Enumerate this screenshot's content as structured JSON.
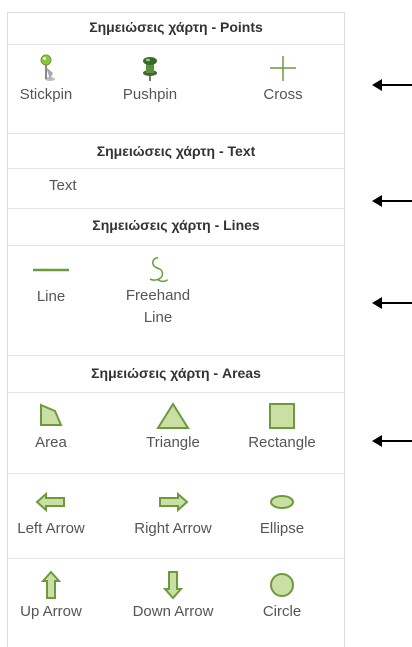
{
  "sections": [
    {
      "header": "Σημειώσεις χάρτη - Points",
      "tools": [
        {
          "label": "Stickpin",
          "icon": "stickpin-icon"
        },
        {
          "label": "Pushpin",
          "icon": "pushpin-icon"
        },
        {
          "label": "Cross",
          "icon": "cross-icon"
        }
      ]
    },
    {
      "header": "Σημειώσεις χάρτη - Text",
      "tools": [
        {
          "label": "Text",
          "icon": "text-tool"
        }
      ]
    },
    {
      "header": "Σημειώσεις χάρτη - Lines",
      "tools": [
        {
          "label": "Line",
          "icon": "line-icon"
        },
        {
          "label": "Freehand Line",
          "icon": "freehand-line-icon"
        }
      ]
    },
    {
      "header": "Σημειώσεις χάρτη - Areas",
      "tools": [
        {
          "label": "Area",
          "icon": "area-icon"
        },
        {
          "label": "Triangle",
          "icon": "triangle-icon"
        },
        {
          "label": "Rectangle",
          "icon": "rectangle-icon"
        },
        {
          "label": "Left Arrow",
          "icon": "left-arrow-icon"
        },
        {
          "label": "Right Arrow",
          "icon": "right-arrow-icon"
        },
        {
          "label": "Ellipse",
          "icon": "ellipse-icon"
        },
        {
          "label": "Up Arrow",
          "icon": "up-arrow-icon"
        },
        {
          "label": "Down Arrow",
          "icon": "down-arrow-icon"
        },
        {
          "label": "Circle",
          "icon": "circle-icon"
        }
      ]
    }
  ],
  "colors": {
    "fill": "#c9dfa4",
    "stroke": "#78a046",
    "line": "#6d9a3c",
    "pin_head": "#8cc63f",
    "pin_dark": "#3a6a2a"
  }
}
